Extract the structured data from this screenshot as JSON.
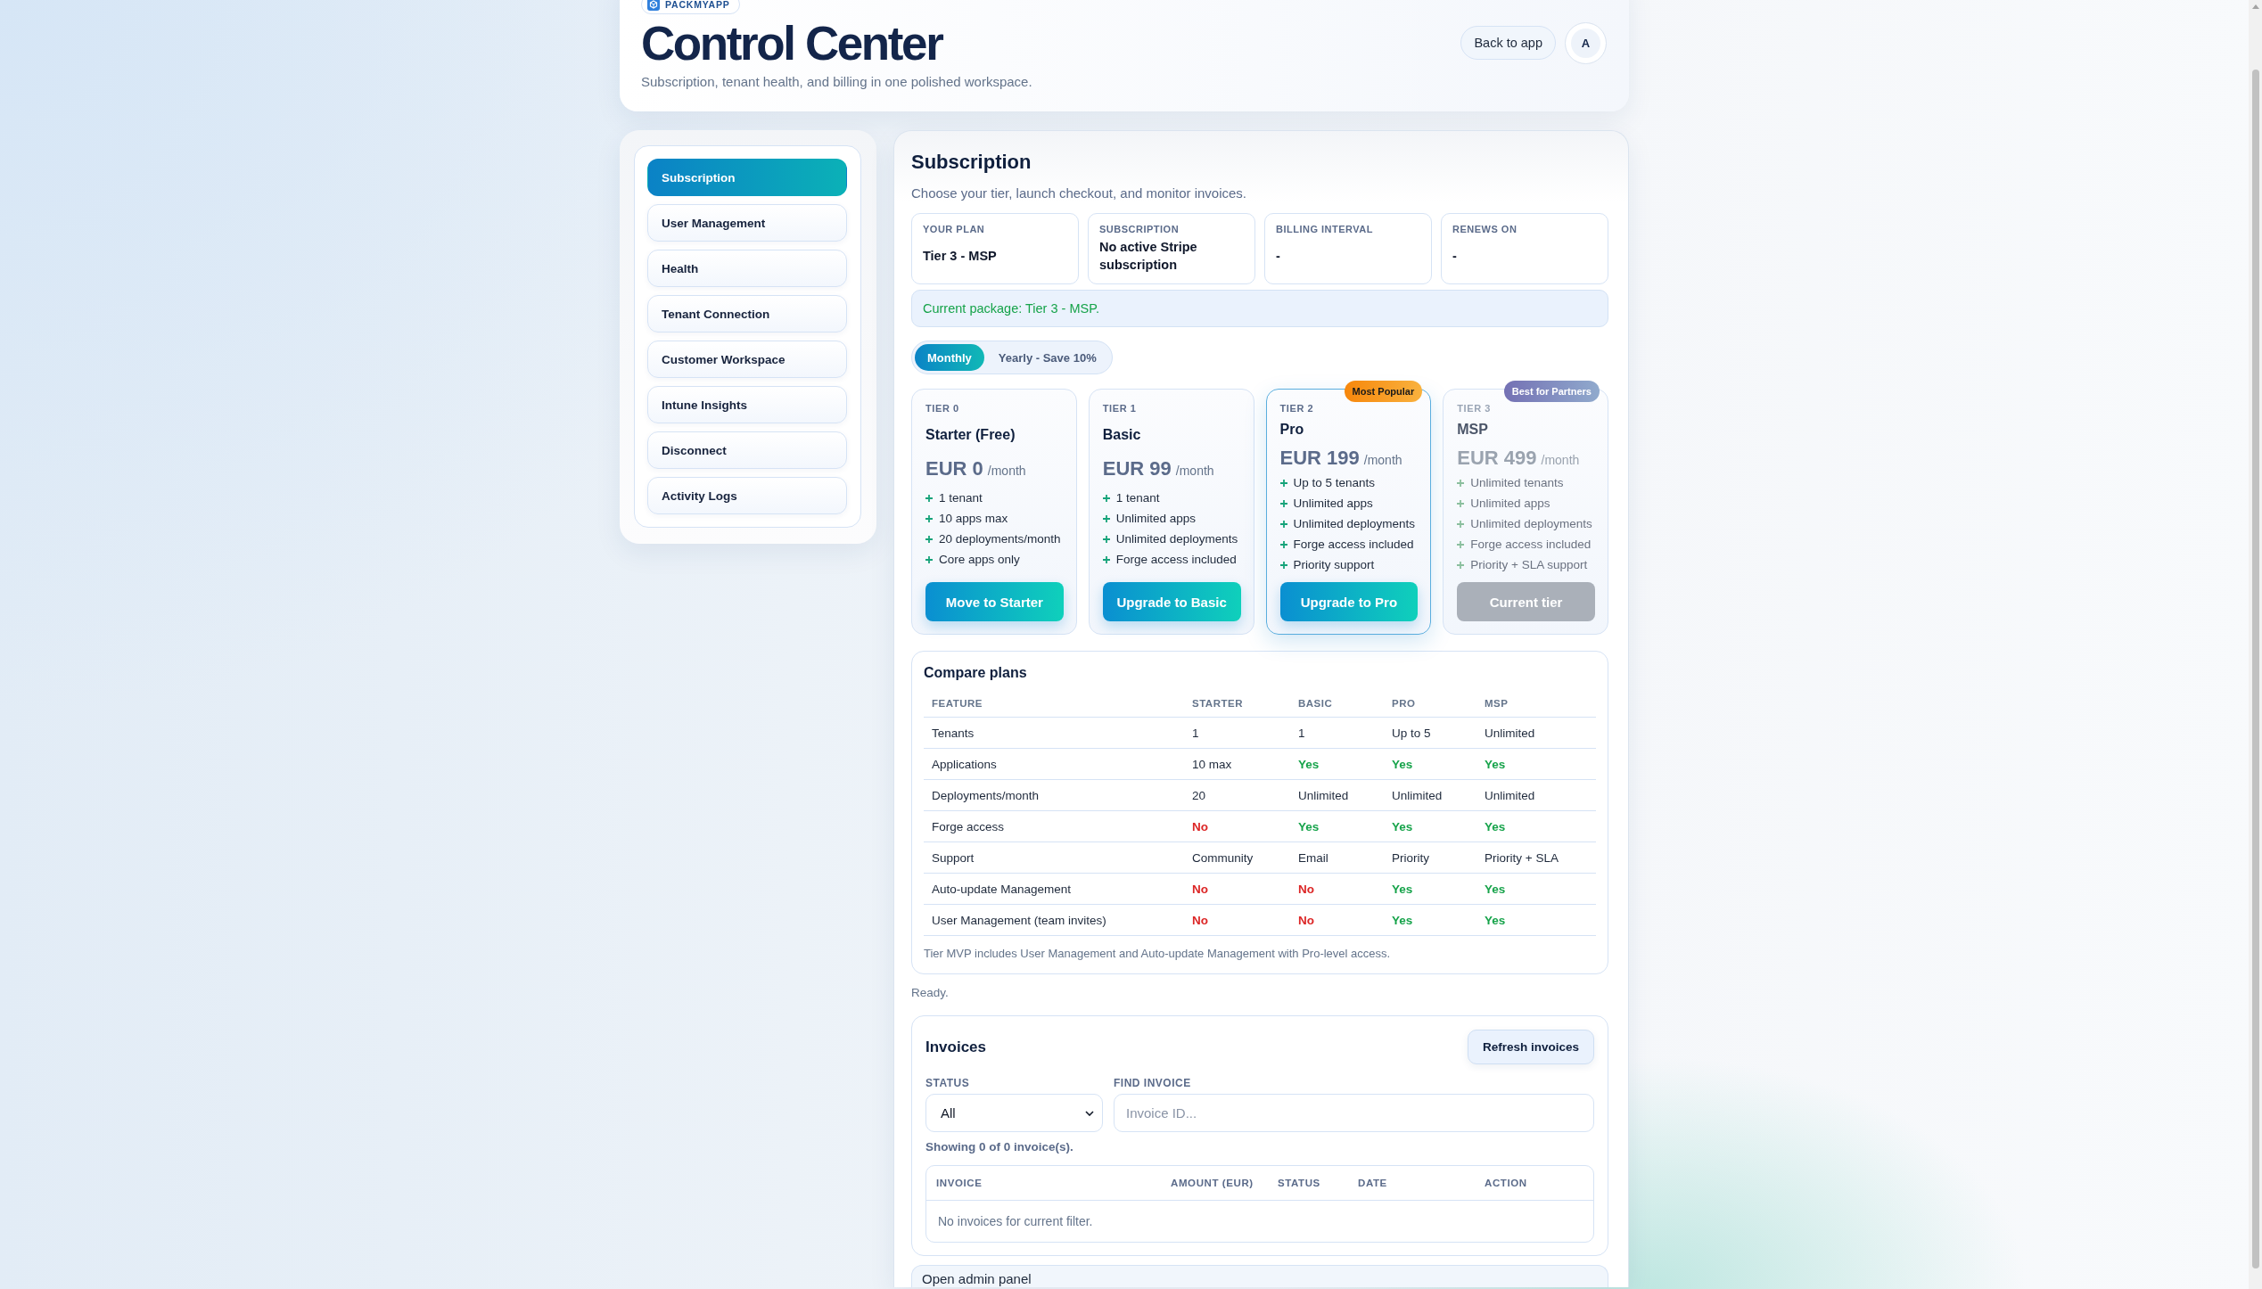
{
  "brand": {
    "name": "PACKMYAPP"
  },
  "header": {
    "title": "Control Center",
    "subtitle": "Subscription, tenant health, and billing in one polished workspace.",
    "back_button": "Back to app",
    "avatar": "A"
  },
  "sidebar": {
    "items": [
      {
        "label": "Subscription",
        "selected": true
      },
      {
        "label": "User Management",
        "selected": false
      },
      {
        "label": "Health",
        "selected": false
      },
      {
        "label": "Tenant Connection",
        "selected": false
      },
      {
        "label": "Customer Workspace",
        "selected": false
      },
      {
        "label": "Intune Insights",
        "selected": false
      },
      {
        "label": "Disconnect",
        "selected": false
      },
      {
        "label": "Activity Logs",
        "selected": false
      }
    ]
  },
  "subscription": {
    "title": "Subscription",
    "subtitle": "Choose your tier, launch checkout, and monitor invoices.",
    "stats": [
      {
        "label": "YOUR PLAN",
        "value": "Tier 3 - MSP"
      },
      {
        "label": "SUBSCRIPTION",
        "value": "No active Stripe subscription"
      },
      {
        "label": "BILLING INTERVAL",
        "value": "-"
      },
      {
        "label": "RENEWS ON",
        "value": "-"
      }
    ],
    "notice": "Current package: Tier 3 - MSP.",
    "billing_options": [
      {
        "label": "Monthly",
        "selected": true
      },
      {
        "label": "Yearly - Save 10%",
        "selected": false
      }
    ],
    "tiers": [
      {
        "tier": "TIER 0",
        "name": "Starter (Free)",
        "price": "EUR 0",
        "period": "/month",
        "features": [
          "1 tenant",
          "10 apps max",
          "20 deployments/month",
          "Core apps only"
        ],
        "button": "Move to Starter",
        "featured": false,
        "current": false
      },
      {
        "tier": "TIER 1",
        "name": "Basic",
        "price": "EUR 99",
        "period": "/month",
        "features": [
          "1 tenant",
          "Unlimited apps",
          "Unlimited deployments",
          "Forge access included"
        ],
        "button": "Upgrade to Basic",
        "featured": false,
        "current": false
      },
      {
        "tier": "TIER 2",
        "name": "Pro",
        "price": "EUR 199",
        "period": "/month",
        "features": [
          "Up to 5 tenants",
          "Unlimited apps",
          "Unlimited deployments",
          "Forge access included",
          "Priority support"
        ],
        "button": "Upgrade to Pro",
        "featured": true,
        "current": false,
        "badge": {
          "text": "Most Popular",
          "kind": "popular"
        }
      },
      {
        "tier": "TIER 3",
        "name": "MSP",
        "price": "EUR 499",
        "period": "/month",
        "features": [
          "Unlimited tenants",
          "Unlimited apps",
          "Unlimited deployments",
          "Forge access included",
          "Priority + SLA support"
        ],
        "button": "Current tier",
        "featured": false,
        "current": true,
        "badge": {
          "text": "Best for Partners",
          "kind": "partner"
        }
      }
    ],
    "compare": {
      "title": "Compare plans",
      "columns": [
        "FEATURE",
        "STARTER",
        "BASIC",
        "PRO",
        "MSP"
      ],
      "rows": [
        {
          "cells": [
            {
              "text": "Tenants",
              "kind": "plain"
            },
            {
              "text": "1",
              "kind": "plain"
            },
            {
              "text": "1",
              "kind": "plain"
            },
            {
              "text": "Up to 5",
              "kind": "plain"
            },
            {
              "text": "Unlimited",
              "kind": "plain"
            }
          ]
        },
        {
          "cells": [
            {
              "text": "Applications",
              "kind": "plain"
            },
            {
              "text": "10 max",
              "kind": "plain"
            },
            {
              "text": "Yes",
              "kind": "yes"
            },
            {
              "text": "Yes",
              "kind": "yes"
            },
            {
              "text": "Yes",
              "kind": "yes"
            }
          ]
        },
        {
          "cells": [
            {
              "text": "Deployments/month",
              "kind": "plain"
            },
            {
              "text": "20",
              "kind": "plain"
            },
            {
              "text": "Unlimited",
              "kind": "plain"
            },
            {
              "text": "Unlimited",
              "kind": "plain"
            },
            {
              "text": "Unlimited",
              "kind": "plain"
            }
          ]
        },
        {
          "cells": [
            {
              "text": "Forge access",
              "kind": "plain"
            },
            {
              "text": "No",
              "kind": "no"
            },
            {
              "text": "Yes",
              "kind": "yes"
            },
            {
              "text": "Yes",
              "kind": "yes"
            },
            {
              "text": "Yes",
              "kind": "yes"
            }
          ]
        },
        {
          "cells": [
            {
              "text": "Support",
              "kind": "plain"
            },
            {
              "text": "Community",
              "kind": "plain"
            },
            {
              "text": "Email",
              "kind": "plain"
            },
            {
              "text": "Priority",
              "kind": "plain"
            },
            {
              "text": "Priority + SLA",
              "kind": "plain"
            }
          ]
        },
        {
          "cells": [
            {
              "text": "Auto-update Management",
              "kind": "plain"
            },
            {
              "text": "No",
              "kind": "no"
            },
            {
              "text": "No",
              "kind": "no"
            },
            {
              "text": "Yes",
              "kind": "yes"
            },
            {
              "text": "Yes",
              "kind": "yes"
            }
          ]
        },
        {
          "cells": [
            {
              "text": "User Management (team invites)",
              "kind": "plain"
            },
            {
              "text": "No",
              "kind": "no"
            },
            {
              "text": "No",
              "kind": "no"
            },
            {
              "text": "Yes",
              "kind": "yes"
            },
            {
              "text": "Yes",
              "kind": "yes"
            }
          ]
        }
      ],
      "note": "Tier MVP includes User Management and Auto-update Management with Pro-level access."
    },
    "status_text": "Ready.",
    "invoices": {
      "title": "Invoices",
      "refresh_button": "Refresh invoices",
      "status_filter": {
        "label": "STATUS",
        "value": "All"
      },
      "search": {
        "label": "FIND INVOICE",
        "placeholder": "Invoice ID..."
      },
      "summary": "Showing 0 of 0 invoice(s).",
      "table": {
        "columns": [
          "INVOICE",
          "AMOUNT (EUR)",
          "STATUS",
          "DATE",
          "ACTION"
        ],
        "empty_text": "No invoices for current filter."
      }
    },
    "admin_panel": "Open admin panel"
  }
}
